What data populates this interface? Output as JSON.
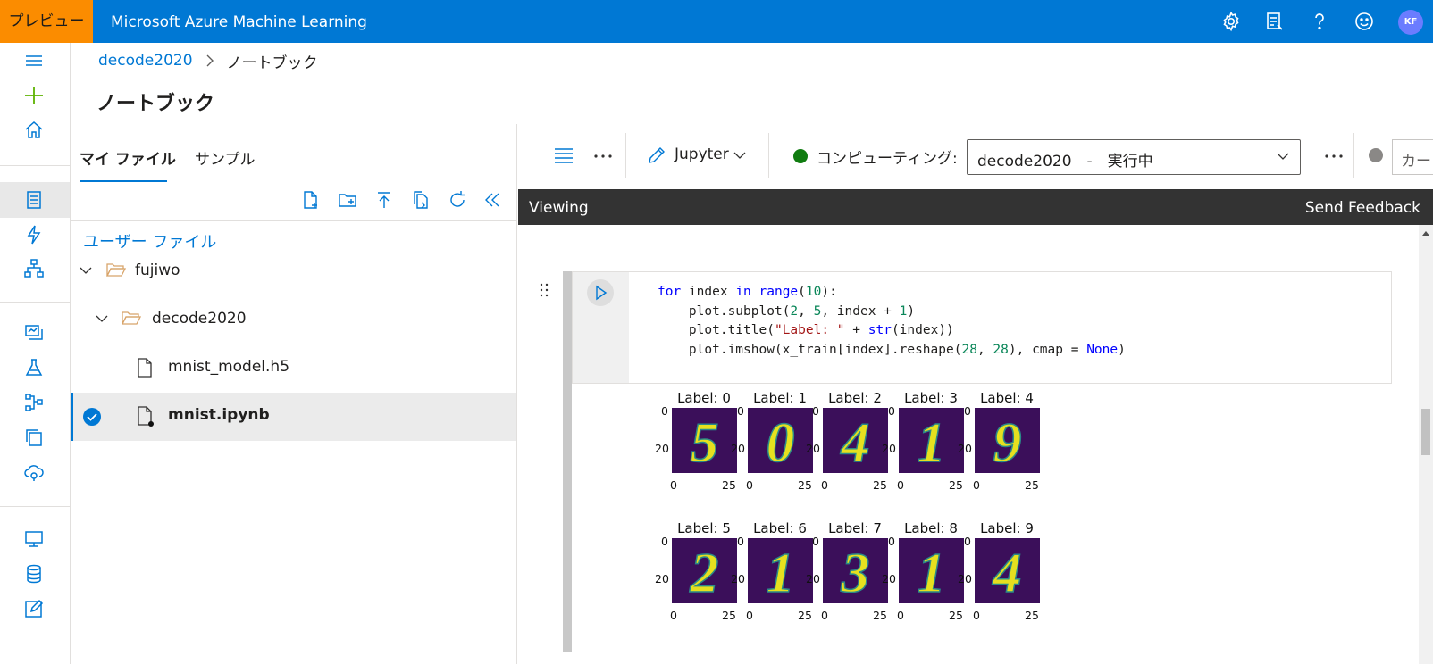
{
  "topbar": {
    "preview_badge": "プレビュー",
    "app_title": "Microsoft Azure Machine Learning",
    "icons": [
      "settings-icon",
      "feedback-list-icon",
      "help-icon",
      "smiley-icon"
    ],
    "avatar_initials": "KF"
  },
  "breadcrumb": {
    "workspace": "decode2020",
    "current": "ノートブック"
  },
  "page": {
    "title": "ノートブック"
  },
  "file_panel": {
    "tabs": [
      "マイ ファイル",
      "サンプル"
    ],
    "active_tab": 0,
    "section_label": "ユーザー ファイル",
    "tree": [
      {
        "label": "fujiwo",
        "type": "folder",
        "expanded": true
      },
      {
        "label": "decode2020",
        "type": "folder",
        "expanded": true
      },
      {
        "label": "mnist_model.h5",
        "type": "file"
      },
      {
        "label": "mnist.ipynb",
        "type": "notebook",
        "selected": true
      }
    ]
  },
  "toolbar": {
    "editor_mode": "Jupyter",
    "compute_label": "コンピューティング:",
    "compute_value": "decode2020　-　実行中",
    "compute_status_color": "#107c10",
    "kernel_label": "カー"
  },
  "viewing_bar": {
    "label": "Viewing",
    "feedback": "Send Feedback"
  },
  "cell": {
    "code_lines": [
      "for index in range(10):",
      "    plot.subplot(2, 5, index + 1)",
      "    plot.title(\"Label: \" + str(index))",
      "    plot.imshow(x_train[index].reshape(28, 28), cmap = None)"
    ],
    "output": {
      "captions": [
        "Label: 0",
        "Label: 1",
        "Label: 2",
        "Label: 3",
        "Label: 4",
        "Label: 5",
        "Label: 6",
        "Label: 7",
        "Label: 8",
        "Label: 9"
      ],
      "digits": [
        "5",
        "0",
        "4",
        "1",
        "9",
        "2",
        "1",
        "3",
        "1",
        "4"
      ],
      "y_ticks": [
        "0",
        "20"
      ],
      "x_ticks": [
        "0",
        "25"
      ]
    }
  },
  "colors": {
    "accent": "#0078d4",
    "preview": "#fb8c00",
    "viridis_bg": "#3b0f5a",
    "viridis_fg": "#e6e01f"
  }
}
